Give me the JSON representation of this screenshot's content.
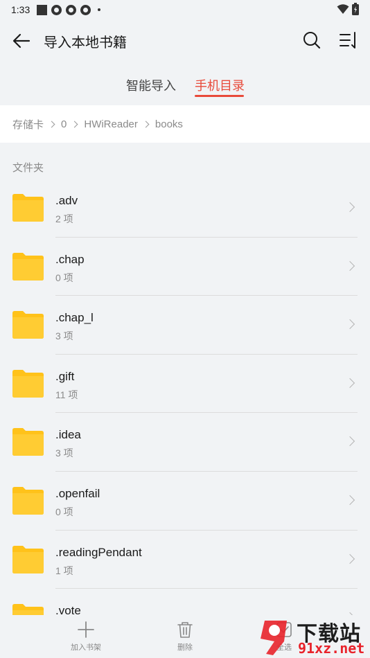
{
  "status_bar": {
    "time": "1:33"
  },
  "header": {
    "title": "导入本地书籍"
  },
  "tabs": [
    {
      "label": "智能导入"
    },
    {
      "label": "手机目录"
    }
  ],
  "breadcrumb": [
    "存储卡",
    "0",
    "HWiReader",
    "books"
  ],
  "section_title": "文件夹",
  "folders": [
    {
      "name": ".adv",
      "count": "2 项"
    },
    {
      "name": ".chap",
      "count": "0 项"
    },
    {
      "name": ".chap_l",
      "count": "3 项"
    },
    {
      "name": ".gift",
      "count": "11 项"
    },
    {
      "name": ".idea",
      "count": "3 项"
    },
    {
      "name": ".openfail",
      "count": "0 项"
    },
    {
      "name": ".readingPendant",
      "count": "1 项"
    },
    {
      "name": ".vote",
      "count": ""
    }
  ],
  "bottom_bar": {
    "add_label": "加入书架",
    "delete_label": "删除",
    "select_label": "全选"
  },
  "watermark": {
    "text": "下载站",
    "url": "91xz.net"
  },
  "colors": {
    "accent": "#e84a3a",
    "folder": "#ffc21a",
    "background": "#f1f3f5"
  }
}
